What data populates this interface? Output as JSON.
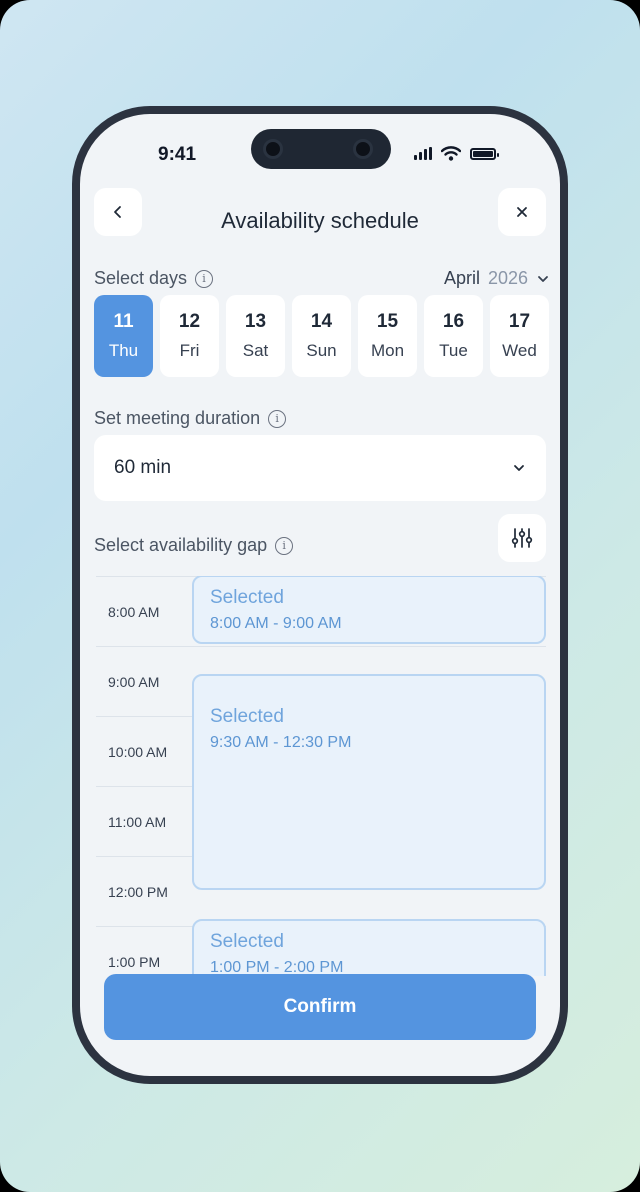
{
  "status": {
    "time": "9:41"
  },
  "header": {
    "title": "Availability schedule"
  },
  "days_section": {
    "label": "Select days",
    "month": "April",
    "year": "2026",
    "days": [
      {
        "num": "11",
        "dow": "Thu",
        "selected": true
      },
      {
        "num": "12",
        "dow": "Fri",
        "selected": false
      },
      {
        "num": "13",
        "dow": "Sat",
        "selected": false
      },
      {
        "num": "14",
        "dow": "Sun",
        "selected": false
      },
      {
        "num": "15",
        "dow": "Mon",
        "selected": false
      },
      {
        "num": "16",
        "dow": "Tue",
        "selected": false
      },
      {
        "num": "17",
        "dow": "Wed",
        "selected": false
      }
    ]
  },
  "duration": {
    "label": "Set meeting duration",
    "value": "60 min"
  },
  "gap": {
    "label": "Select availability gap",
    "times": [
      "8:00 AM",
      "9:00 AM",
      "10:00 AM",
      "11:00 AM",
      "12:00 PM",
      "1:00 PM"
    ],
    "slots": [
      {
        "status": "Selected",
        "range": "8:00 AM - 9:00 AM"
      },
      {
        "status": "Selected",
        "range": "9:30 AM - 12:30 PM"
      },
      {
        "status": "Selected",
        "range": "1:00 PM - 2:00 PM"
      }
    ]
  },
  "actions": {
    "confirm": "Confirm"
  },
  "colors": {
    "accent": "#5494e0",
    "slot_bg": "#e9f2fb",
    "slot_border": "#b9d5f2"
  },
  "icons": {
    "back": "chevron-left-icon",
    "close": "close-icon",
    "info": "info-icon",
    "dropdown": "chevron-down-icon",
    "filter": "sliders-icon"
  }
}
